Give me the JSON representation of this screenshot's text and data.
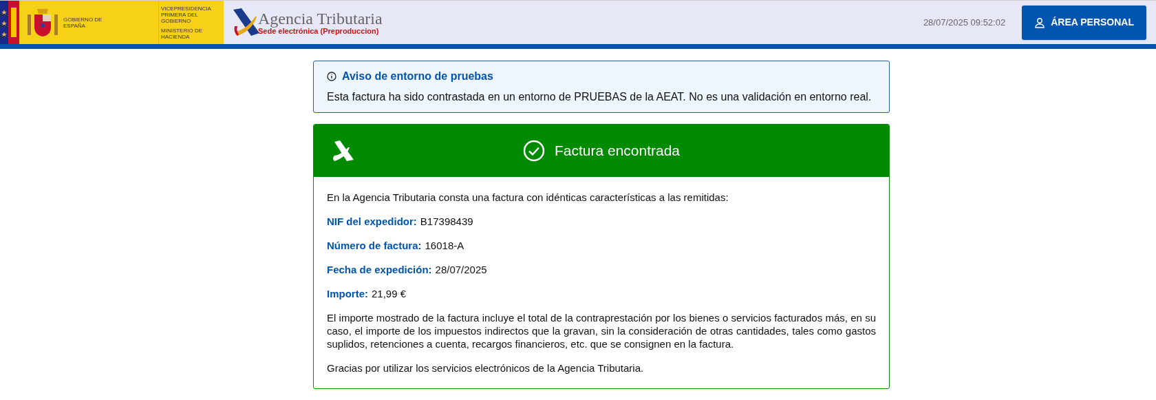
{
  "header": {
    "gov_text": "GOBIERNO DE ESPAÑA",
    "vice_text": "VICEPRESIDENCIA PRIMERA DEL GOBIERNO",
    "ministry_text": "MINISTERIO DE HACIENDA",
    "agency_name": "Agencia Tributaria",
    "agency_subtitle": "Sede electrónica (Preproduccion)",
    "datetime": "28/07/2025 09:52:02",
    "personal_button": "ÁREA PERSONAL"
  },
  "notice": {
    "title": "Aviso de entorno de pruebas",
    "text": "Esta factura ha sido contrastada en un entorno de PRUEBAS de la AEAT. No es una validación en entorno real."
  },
  "result": {
    "title": "Factura encontrada",
    "intro": "En la Agencia Tributaria consta una factura con idénticas características a las remitidas:",
    "fields": [
      {
        "label": "NIF del expedidor:",
        "value": "B17398439"
      },
      {
        "label": "Número de factura:",
        "value": "16018-A"
      },
      {
        "label": "Fecha de expedición:",
        "value": "28/07/2025"
      },
      {
        "label": "Importe:",
        "value": "21,99 €"
      }
    ],
    "disclaimer": "El importe mostrado de la factura incluye el total de la contraprestación por los bienes o servicios facturados más, en su caso, el importe de los impuestos indirectos que la gravan, sin la consideración de otras cantidades, tales como gastos suplidos, retenciones a cuenta, recargos financieros, etc. que se consignen en la factura.",
    "thanks": "Gracias por utilizar los servicios electrónicos de la Agencia Tributaria."
  }
}
